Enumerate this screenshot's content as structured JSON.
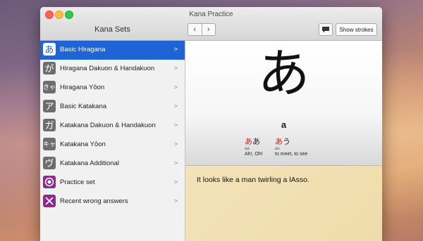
{
  "window": {
    "title": "Kana Practice"
  },
  "sidebar": {
    "title": "Kana Sets",
    "items": [
      {
        "icon_char": "あ",
        "icon": "hiragana-a-icon",
        "label": "Basic Hiragana",
        "selected": true
      },
      {
        "icon_char": "が",
        "icon": "hiragana-ga-icon",
        "label": "Hiragana Dakuon & Handakuon"
      },
      {
        "icon_char": "きゃ",
        "icon": "hiragana-kya-icon",
        "label": "Hiragana Yōon"
      },
      {
        "icon_char": "ア",
        "icon": "katakana-a-icon",
        "label": "Basic Katakana"
      },
      {
        "icon_char": "ガ",
        "icon": "katakana-ga-icon",
        "label": "Katakana Dakuon & Handakuon"
      },
      {
        "icon_char": "キャ",
        "icon": "katakana-kya-icon",
        "label": "Katakana Yōon"
      },
      {
        "icon_char": "ヴ",
        "icon": "katakana-vu-icon",
        "label": "Katakana Additional"
      },
      {
        "icon_char": "",
        "icon": "target-icon",
        "label": "Practice set"
      },
      {
        "icon_char": "",
        "icon": "x-icon",
        "label": "Recent wrong answers"
      }
    ]
  },
  "toolbar": {
    "back": "‹",
    "forward": "›",
    "show_strokes": "Show strokes"
  },
  "card": {
    "kana": "あ",
    "romaji": "a",
    "examples": [
      {
        "kana_highlight": "あ",
        "kana_rest": "あ",
        "romaji": "aa",
        "meaning": "Ah!, Oh!"
      },
      {
        "kana_highlight": "あ",
        "kana_rest": "う",
        "romaji": "au",
        "meaning": "to meet, to see"
      }
    ]
  },
  "note": {
    "text": "It looks like a man twirling a lAsso."
  },
  "colors": {
    "selection": "#1f63d6",
    "note_bg": "#f3e3b8",
    "highlight": "#d42020",
    "special_icon": "#8b2a8a"
  }
}
